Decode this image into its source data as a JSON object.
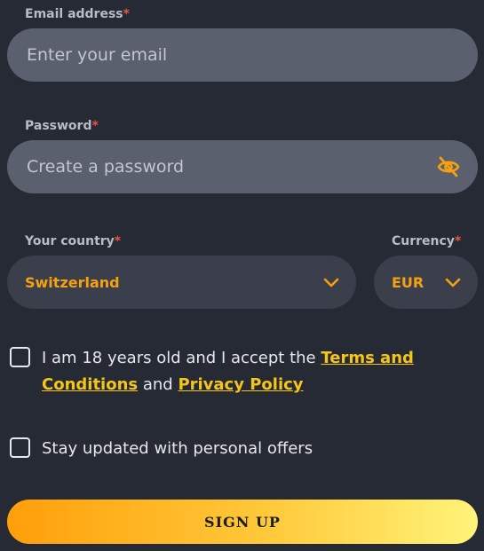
{
  "email": {
    "label": "Email address",
    "required_mark": "*",
    "placeholder": "Enter your email",
    "value": ""
  },
  "password": {
    "label": "Password",
    "required_mark": "*",
    "placeholder": "Create a password",
    "value": "",
    "toggle_icon": "eye-off-icon"
  },
  "country": {
    "label": "Your country",
    "required_mark": "*",
    "selected": "Switzerland",
    "icon": "chevron-down-icon"
  },
  "currency": {
    "label": "Currency",
    "required_mark": "*",
    "selected": "EUR",
    "icon": "chevron-down-icon"
  },
  "terms": {
    "text_before": "I am 18 years old and I accept the ",
    "terms_link": "Terms and Conditions",
    "text_middle": " and ",
    "privacy_link": "Privacy Policy",
    "checked": false
  },
  "offers": {
    "text": "Stay updated with personal offers",
    "checked": false
  },
  "signup_button": {
    "label": "SIGN UP"
  },
  "colors": {
    "background": "#262a34",
    "input_bg": "#5b606e",
    "select_bg": "#3a3f4b",
    "accent": "#f5a110",
    "link": "#f5c518",
    "required": "#e8563f"
  }
}
